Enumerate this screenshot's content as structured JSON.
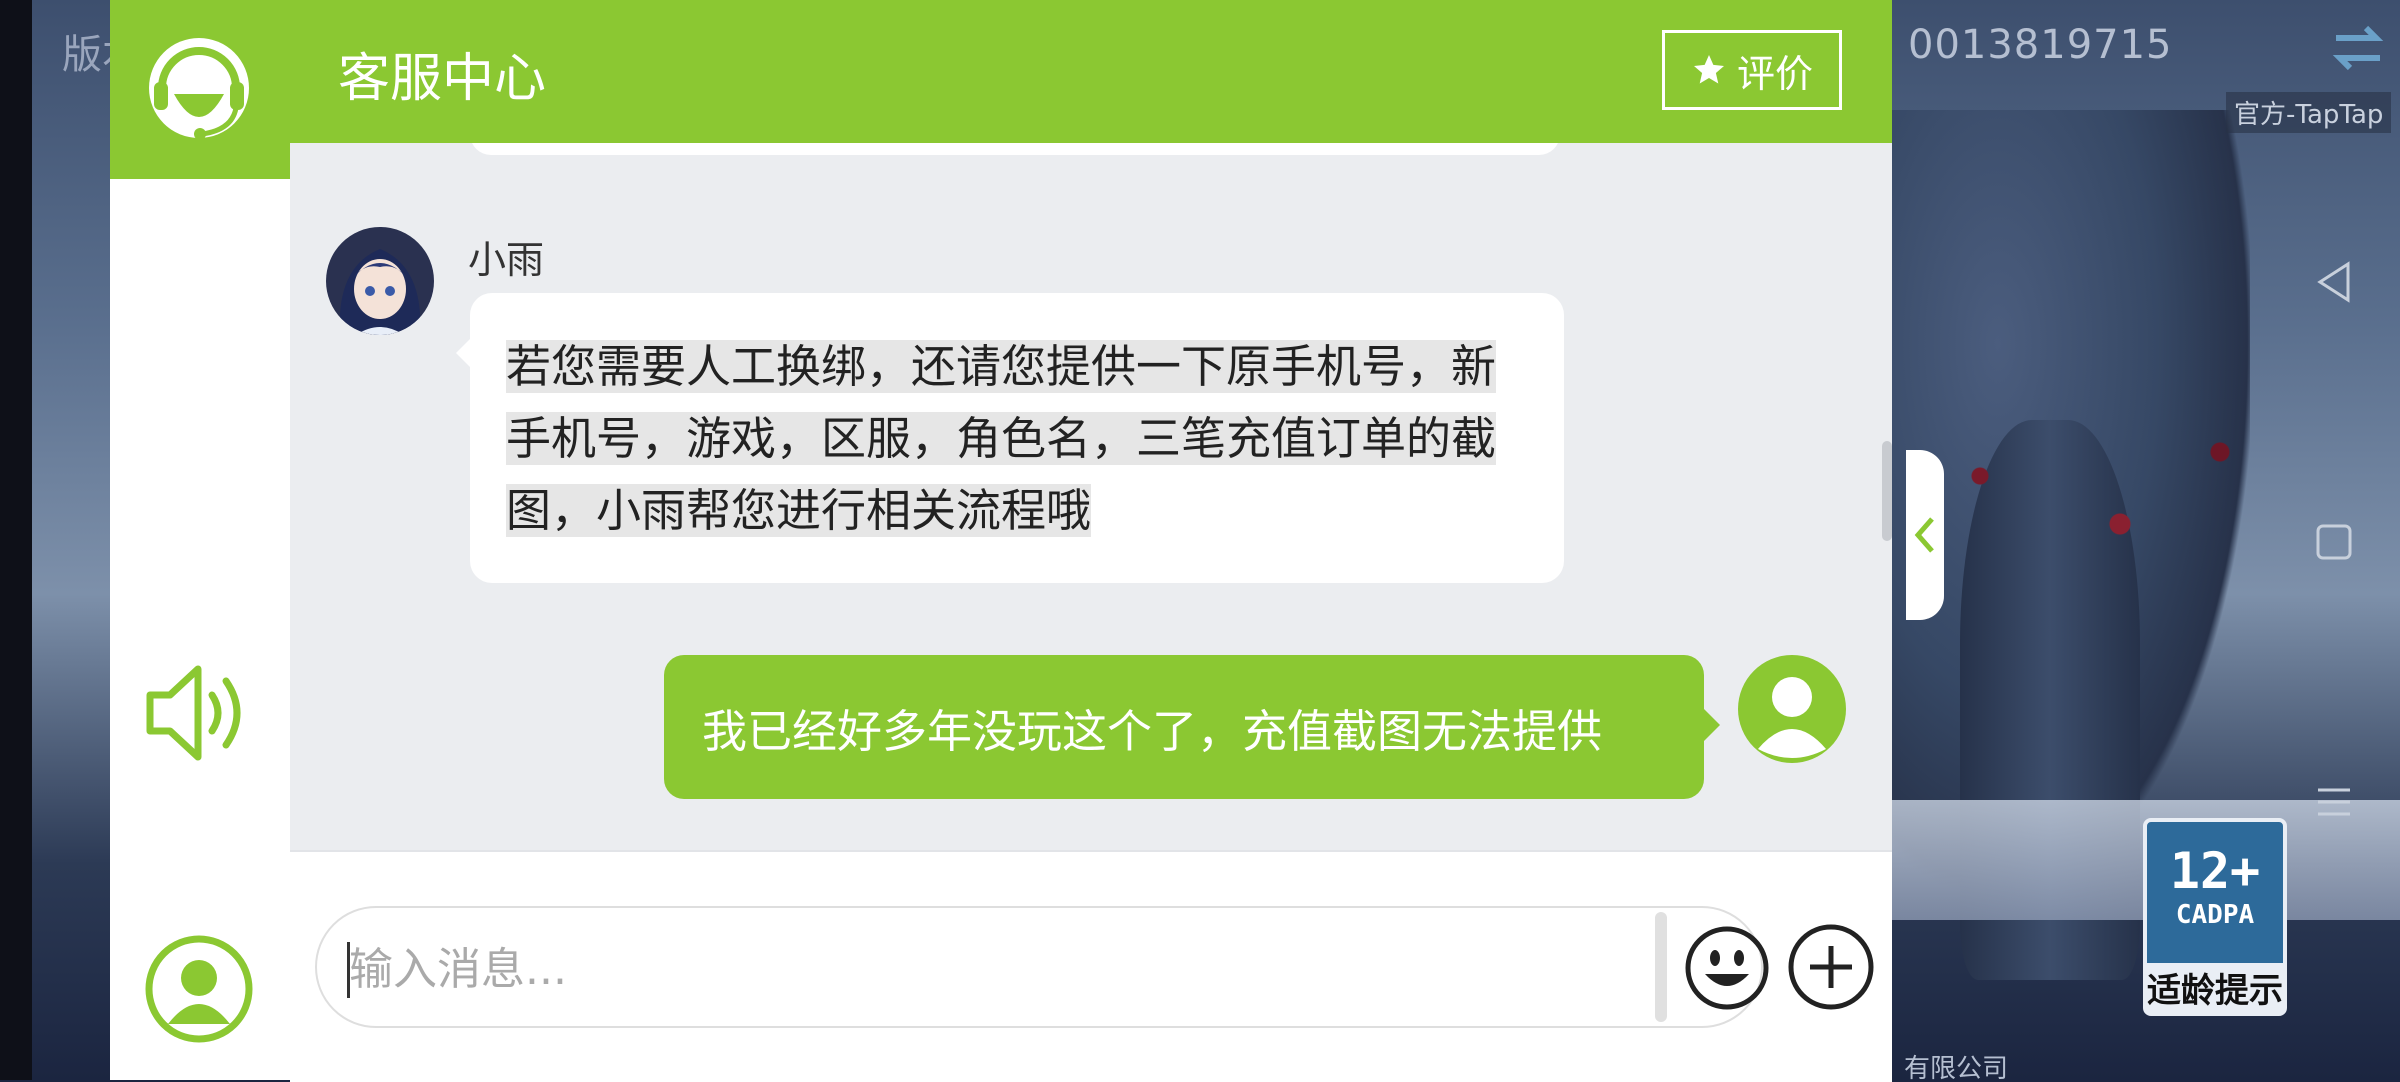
{
  "background": {
    "left_text": "版本",
    "phone_text": "0013819715",
    "store_label": "官方-TapTap",
    "company_text": "有限公司",
    "age_rating": {
      "number": "12+",
      "org": "CADPA",
      "tip": "适龄提示"
    }
  },
  "header": {
    "title": "客服中心",
    "rate_label": "评价",
    "color": "#8bc832"
  },
  "messages": {
    "agent": {
      "name": "小雨",
      "text": "若您需要人工换绑，还请您提供一下原手机号，新手机号，游戏，区服，角色名，三笔充值订单的截图，小雨帮您进行相关流程哦"
    },
    "user": {
      "text": "我已经好多年没玩这个了，充值截图无法提供"
    }
  },
  "input": {
    "placeholder": "输入消息...",
    "value": ""
  },
  "icons": [
    "headset-logo-icon",
    "star-icon",
    "speaker-icon",
    "user-icon",
    "emoji-icon",
    "plus-icon",
    "chevron-left-icon",
    "switch-icon",
    "nav-back-icon",
    "nav-home-icon",
    "nav-menu-icon"
  ]
}
